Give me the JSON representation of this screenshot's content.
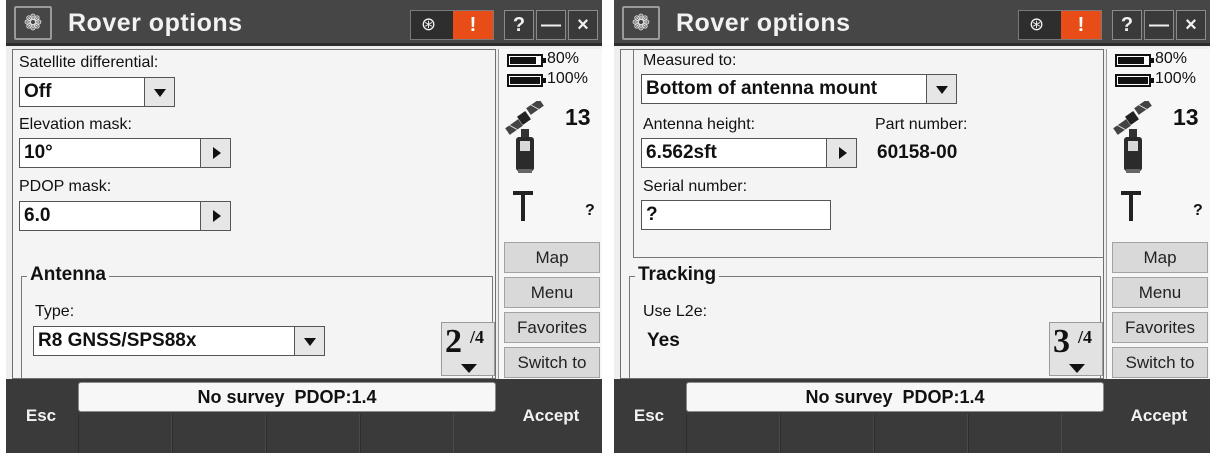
{
  "left": {
    "title": "Rover options",
    "title_buttons": {
      "help": "?",
      "minimize": "—",
      "close": "×"
    },
    "fields": {
      "satellite_differential": {
        "label": "Satellite differential:",
        "value": "Off"
      },
      "elevation_mask": {
        "label": "Elevation mask:",
        "value": "10°"
      },
      "pdop_mask": {
        "label": "PDOP mask:",
        "value": "6.0"
      }
    },
    "group": {
      "title": "Antenna",
      "type_label": "Type:",
      "type_value": "R8 GNSS/SPS88x"
    },
    "page": {
      "current": "2",
      "total": "/4"
    },
    "sidebar": {
      "battery1": "80%",
      "battery2": "100%",
      "satellites": "13",
      "unknown": "?",
      "buttons": [
        "Map",
        "Menu",
        "Favorites",
        "Switch to"
      ]
    },
    "status": "No survey  PDOP:1.4",
    "esc": "Esc",
    "accept": "Accept"
  },
  "right": {
    "title": "Rover options",
    "title_buttons": {
      "help": "?",
      "minimize": "—",
      "close": "×"
    },
    "fields": {
      "measured_to": {
        "label": "Measured to:",
        "value": "Bottom of antenna mount"
      },
      "antenna_height": {
        "label": "Antenna height:",
        "value": "6.562sft"
      },
      "part_number": {
        "label": "Part number:",
        "value": "60158-00"
      },
      "serial_number": {
        "label": "Serial number:",
        "value": "?"
      }
    },
    "group": {
      "title": "Tracking",
      "use_l2e_label": "Use L2e:",
      "use_l2e_value": "Yes"
    },
    "page": {
      "current": "3",
      "total": "/4"
    },
    "sidebar": {
      "battery1": "80%",
      "battery2": "100%",
      "satellites": "13",
      "unknown": "?",
      "buttons": [
        "Map",
        "Menu",
        "Favorites",
        "Switch to"
      ]
    },
    "status": "No survey  PDOP:1.4",
    "esc": "Esc",
    "accept": "Accept"
  },
  "colors": {
    "titlebar": "#464646",
    "alert": "#e84d18",
    "bottombar": "#3a3a3a",
    "panel": "#f4f4f4"
  },
  "icons": {
    "app_logo": "rose-logo-icon",
    "status_a": "satellite-connection-icon",
    "status_b": "alert-icon"
  }
}
